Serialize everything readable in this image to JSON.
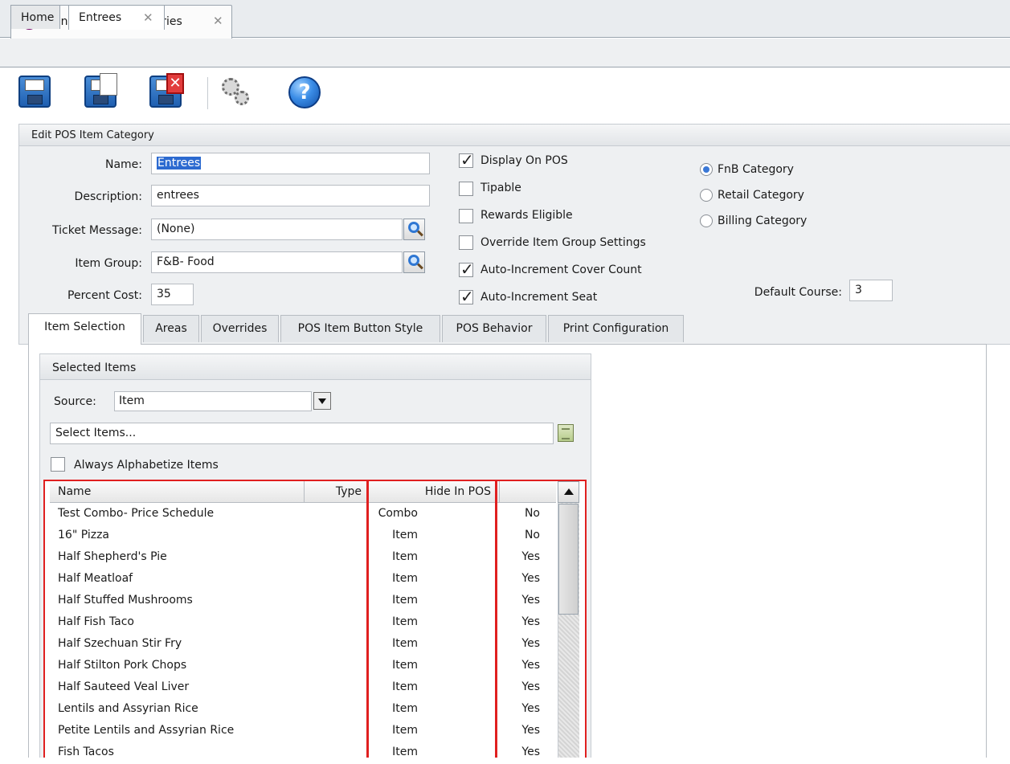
{
  "doc_tab": {
    "title": "Manage Item Categories",
    "close": "✕"
  },
  "sub_tabs": {
    "home": "Home",
    "entrees": "Entrees",
    "close": "✕"
  },
  "toolbar": {
    "help": "?"
  },
  "edit_panel": {
    "title": "Edit POS Item Category",
    "name_label": "Name:",
    "name_value": "Entrees",
    "description_label": "Description:",
    "description_value": "entrees",
    "ticket_message_label": "Ticket Message:",
    "ticket_message_value": "(None)",
    "item_group_label": "Item Group:",
    "item_group_value": "F&B- Food",
    "percent_cost_label": "Percent Cost:",
    "percent_cost_value": "35",
    "checkboxes": [
      {
        "label": "Display On POS",
        "checked": true
      },
      {
        "label": "Tipable",
        "checked": false
      },
      {
        "label": "Rewards Eligible",
        "checked": false
      },
      {
        "label": "Override Item Group Settings",
        "checked": false
      },
      {
        "label": "Auto-Increment Cover Count",
        "checked": true
      },
      {
        "label": "Auto-Increment Seat",
        "checked": true
      }
    ],
    "radios": [
      {
        "label": "FnB Category",
        "selected": true
      },
      {
        "label": "Retail Category",
        "selected": false
      },
      {
        "label": "Billing Category",
        "selected": false
      }
    ],
    "default_course_label": "Default Course:",
    "default_course_value": "3"
  },
  "tabs": [
    "Item Selection",
    "Areas",
    "Overrides",
    "POS Item Button Style",
    "POS Behavior",
    "Print Configuration"
  ],
  "selected_items": {
    "title": "Selected Items",
    "source_label": "Source:",
    "source_value": "Item",
    "select_items_placeholder": "Select Items...",
    "always_alphabetize_label": "Always Alphabetize Items",
    "always_alphabetize_checked": false,
    "columns": {
      "name": "Name",
      "type": "Type",
      "hide": "Hide In POS"
    },
    "rows": [
      {
        "name": "Test Combo- Price Schedule",
        "type": "Combo",
        "hide": "No"
      },
      {
        "name": "16\" Pizza",
        "type": "Item",
        "hide": "No"
      },
      {
        "name": "Half Shepherd's Pie",
        "type": "Item",
        "hide": "Yes"
      },
      {
        "name": "Half Meatloaf",
        "type": "Item",
        "hide": "Yes"
      },
      {
        "name": "Half Stuffed Mushrooms",
        "type": "Item",
        "hide": "Yes"
      },
      {
        "name": "Half Fish Taco",
        "type": "Item",
        "hide": "Yes"
      },
      {
        "name": "Half Szechuan Stir Fry",
        "type": "Item",
        "hide": "Yes"
      },
      {
        "name": "Half Stilton Pork Chops",
        "type": "Item",
        "hide": "Yes"
      },
      {
        "name": "Half Sauteed Veal Liver",
        "type": "Item",
        "hide": "Yes"
      },
      {
        "name": "Lentils and Assyrian Rice",
        "type": "Item",
        "hide": "Yes"
      },
      {
        "name": "Petite Lentils and Assyrian Rice",
        "type": "Item",
        "hide": "Yes"
      },
      {
        "name": "Fish Tacos",
        "type": "Item",
        "hide": "Yes"
      }
    ]
  }
}
